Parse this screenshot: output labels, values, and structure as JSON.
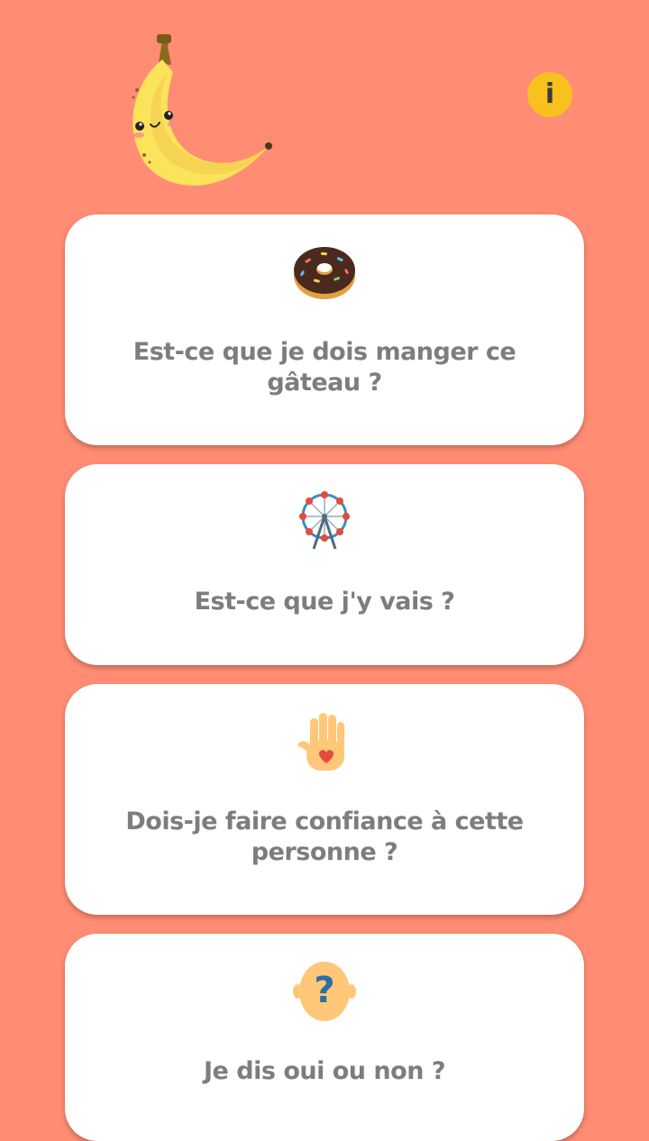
{
  "header": {
    "mascot": "banana-mascot",
    "info_button": {
      "label": "i",
      "icon": "info-icon",
      "color": "#F9C11E"
    }
  },
  "cards": [
    {
      "icon": "donut-icon",
      "label": "Est-ce que je dois manger ce gâteau ?"
    },
    {
      "icon": "ferris-wheel-icon",
      "label": "Est-ce que j'y vais ?"
    },
    {
      "icon": "hand-heart-icon",
      "label": "Dois-je faire confiance à cette personne ?"
    },
    {
      "icon": "question-face-icon",
      "label": "Je dis oui ou non ?"
    }
  ],
  "colors": {
    "background": "#FF8C73",
    "card": "#FFFFFF",
    "text": "#7D7D7D",
    "accent": "#F9C11E"
  }
}
